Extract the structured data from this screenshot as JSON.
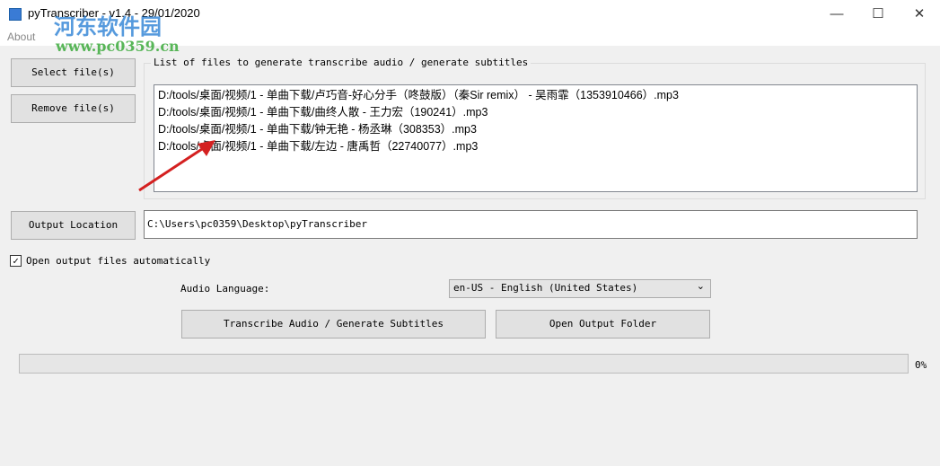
{
  "window": {
    "title": "pyTranscriber - v1.4 - 29/01/2020",
    "minimize": "—",
    "maximize": "☐",
    "close": "✕"
  },
  "menu": {
    "about": "About"
  },
  "watermark": {
    "line1": "河东软件园",
    "line2": "www.pc0359.cn"
  },
  "buttons": {
    "select_files": "Select file(s)",
    "remove_files": "Remove file(s)",
    "output_location": "Output Location",
    "transcribe": "Transcribe Audio / Generate Subtitles",
    "open_folder": "Open Output Folder"
  },
  "files_group": {
    "label": "List of files to generate transcribe audio / generate subtitles",
    "files": [
      "D:/tools/桌面/视频/1 - 单曲下载/卢巧音-好心分手（咚鼓版）（秦Sir remix） - 吴雨霏（1353910466）.mp3",
      "D:/tools/桌面/视频/1 - 单曲下载/曲终人散 - 王力宏（190241）.mp3",
      "D:/tools/桌面/视频/1 - 单曲下载/钟无艳 - 杨丞琳（308353）.mp3",
      "D:/tools/桌面/视频/1 - 单曲下载/左边 - 唐禹哲（22740077）.mp3"
    ]
  },
  "output": {
    "path": "C:\\Users\\pc0359\\Desktop\\pyTranscriber"
  },
  "open_auto": {
    "label": "Open output files automatically",
    "checked": true,
    "mark": "✓"
  },
  "language": {
    "label": "Audio Language:",
    "selected": "en-US - English (United States)",
    "arrow": "⌄"
  },
  "progress": {
    "value": 0,
    "label": "0%"
  }
}
